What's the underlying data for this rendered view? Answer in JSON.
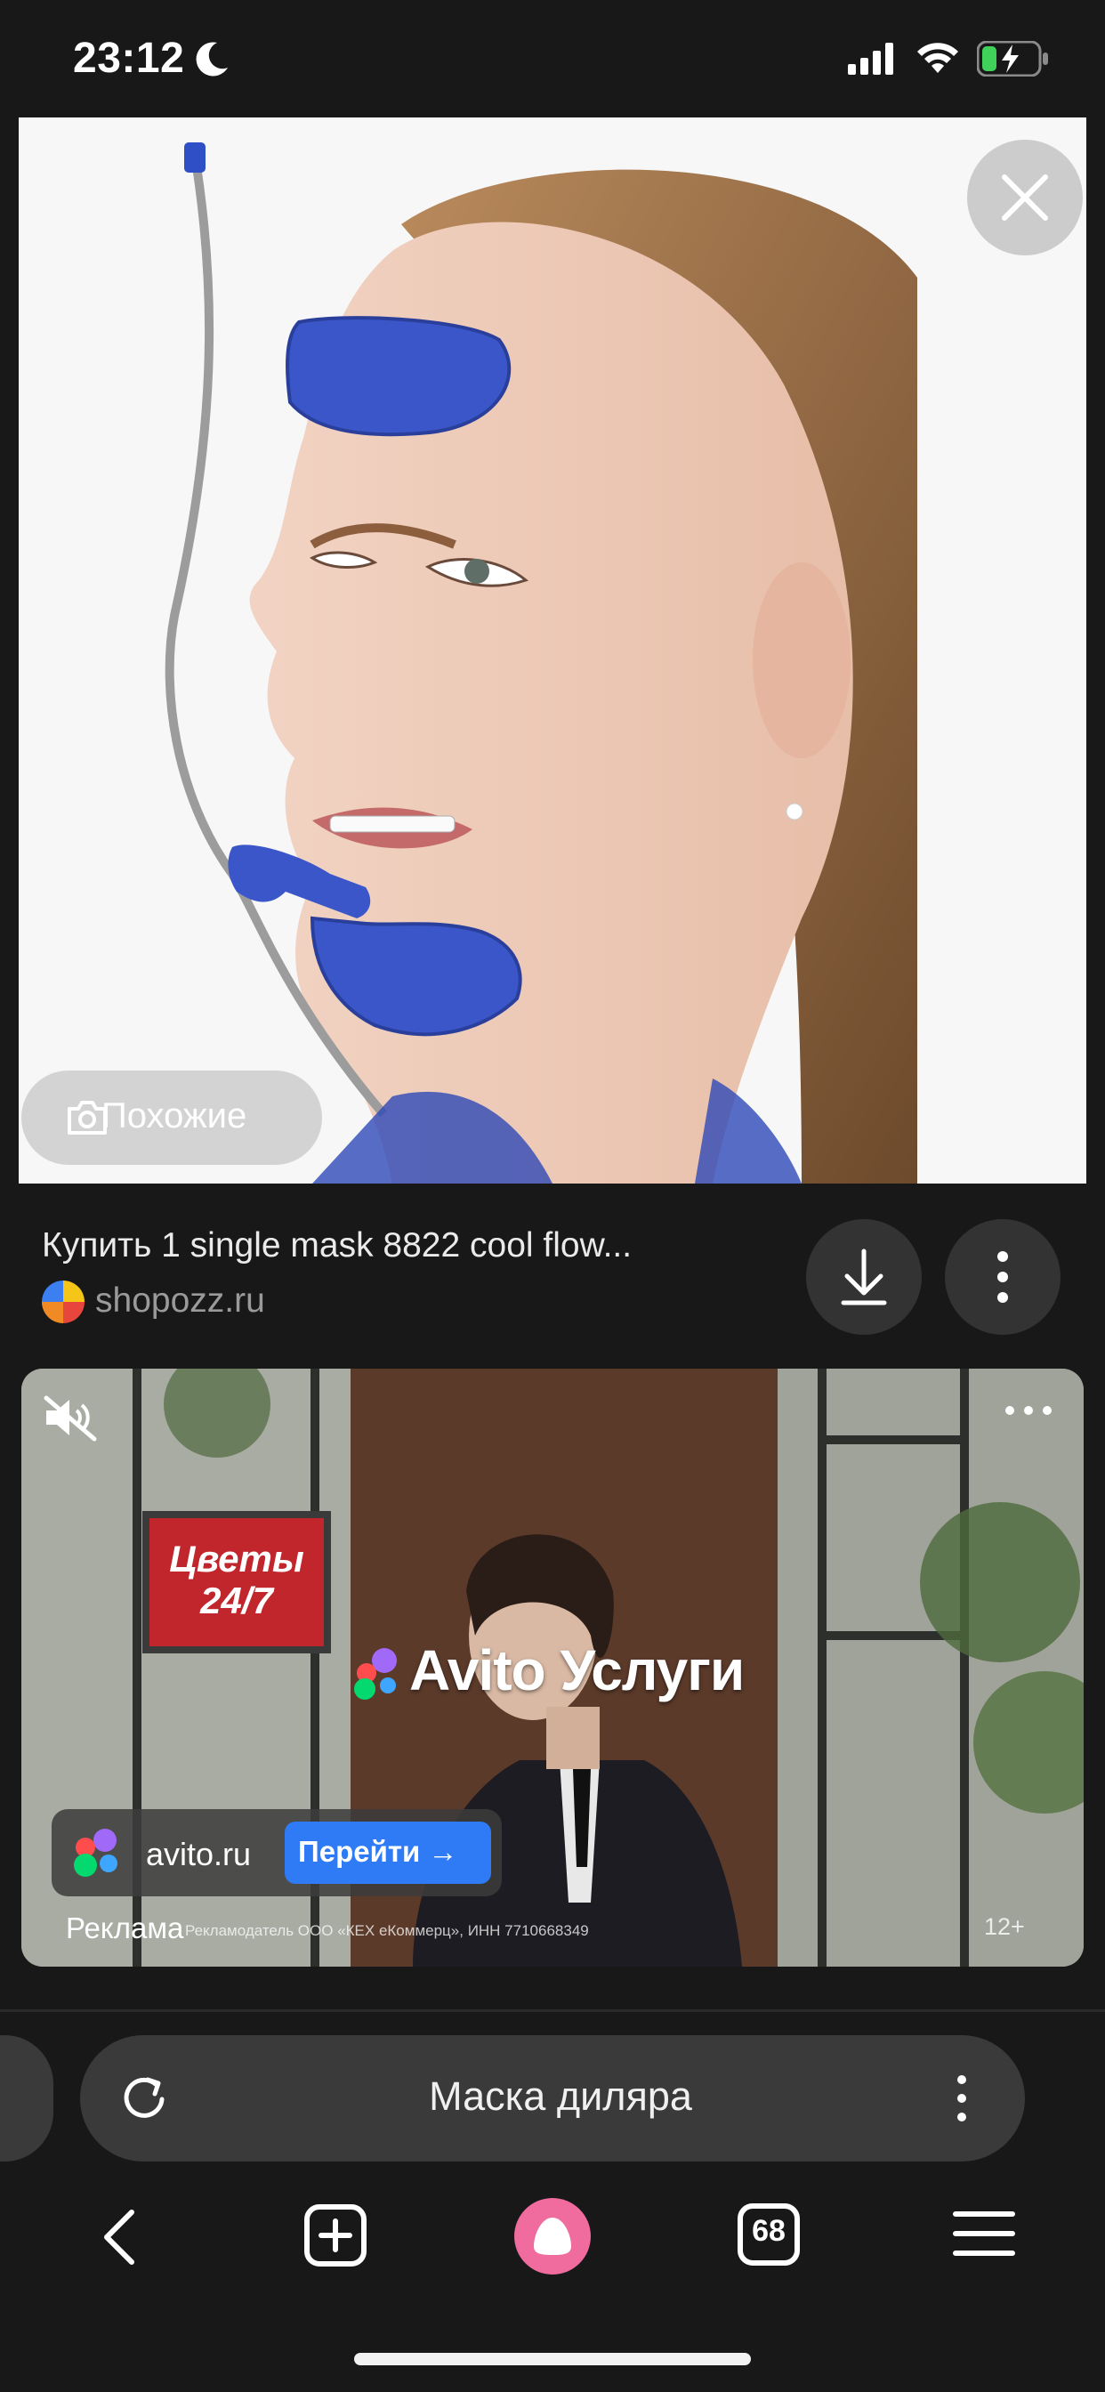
{
  "status_bar": {
    "time": "23:12",
    "icons": [
      "moon-icon",
      "signal-icon",
      "wifi-icon",
      "battery-charging-icon"
    ]
  },
  "image_viewer": {
    "similar_label": "Похожие",
    "close_icon": "close-icon"
  },
  "result": {
    "title": "Купить 1 single mask 8822 cool flow...",
    "source": "shopozz.ru",
    "download_icon": "download-icon",
    "more_icon": "more-vertical-icon"
  },
  "ad": {
    "brand": "Avito Услуги",
    "sign_text": "Цветы 24/7",
    "domain": "avito.ru",
    "go_label": "Перейти",
    "ad_label": "Реклама",
    "disclaimer": "Рекламодатель ООО «КЕХ еКоммерц», ИНН 7710668349",
    "age_rating": "12+",
    "colors": {
      "button": "#2f7bf5"
    }
  },
  "address_bar": {
    "query": "Маска диляра"
  },
  "toolbar": {
    "tabs_count": "68",
    "alice_color": "#f06b9e"
  }
}
